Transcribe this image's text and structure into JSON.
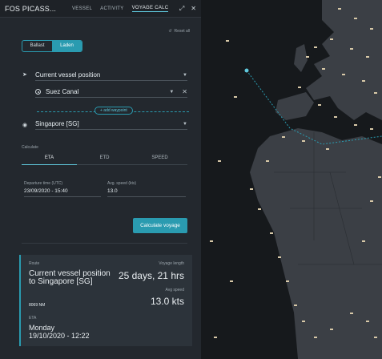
{
  "header": {
    "title": "FOS PICASS...",
    "tabs": [
      "VESSEL",
      "ACTIVITY",
      "VOYAGE CALC"
    ],
    "active_tab": "VOYAGE CALC",
    "expand_icon": "expand-icon",
    "close_icon": "close-icon"
  },
  "reset_label": "Reset all",
  "load_toggle": {
    "options": [
      "Ballast",
      "Laden"
    ],
    "selected": "Laden"
  },
  "route": {
    "origin": "Current vessel position",
    "waypoint": "Suez Canal",
    "add_waypoint": "+ add waypoint",
    "destination": "Singapore [SG]"
  },
  "calculate": {
    "label": "Calculate",
    "tabs": [
      "ETA",
      "ETD",
      "SPEED"
    ],
    "active": "ETA",
    "departure_label": "Departure time (UTC)",
    "departure_value": "23/09/2020 - 15:40",
    "speed_label": "Avg. speed (kts)",
    "speed_value": "13.0",
    "button": "Calculate voyage"
  },
  "result": {
    "route_label": "Route",
    "route_text": "Current vessel position to Singapore [SG]",
    "distance": "8069 NM",
    "voyage_length_label": "Voyage length",
    "voyage_length": "25 days, 21 hrs",
    "avg_speed_label": "Avg speed",
    "avg_speed": "13.0 kts",
    "eta_label": "ETA",
    "eta_day": "Monday",
    "eta_value": "19/10/2020 - 12:22"
  },
  "colors": {
    "accent": "#2a9bb0",
    "panel": "#23282e",
    "land": "#3b3f45",
    "sea": "#16191c"
  }
}
